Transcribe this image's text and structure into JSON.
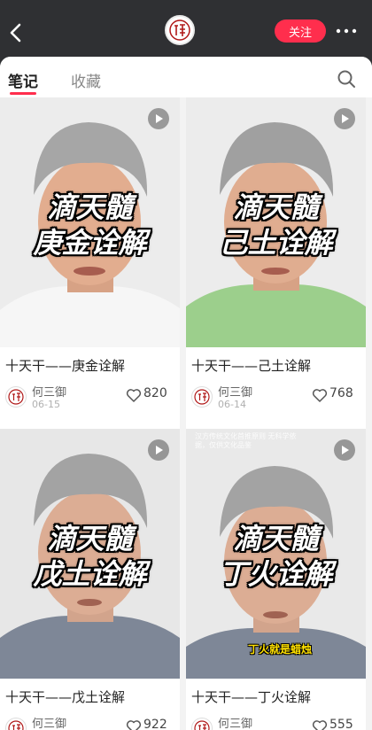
{
  "header": {
    "back_icon": "chevron-left-icon",
    "avatar_icon": "profile-seal-icon",
    "follow_label": "关注",
    "more_icon": "more-dots-icon",
    "accent_color": "#ff2e4d"
  },
  "tabs": [
    {
      "label": "笔记",
      "active": true
    },
    {
      "label": "收藏",
      "active": false
    }
  ],
  "search_icon": "search-icon",
  "cards": [
    {
      "overlay_line1": "滴天髓",
      "overlay_line2": "庚金诠解",
      "title": "十天干——庚金诠解",
      "author": "何三御",
      "date": "06-15",
      "likes": "820",
      "shirt": "#f4f4f4",
      "bg": "#ececec"
    },
    {
      "overlay_line1": "滴天髓",
      "overlay_line2": "己土诠解",
      "title": "十天干——己土诠解",
      "author": "何三御",
      "date": "06-14",
      "likes": "768",
      "shirt": "#9ccf8c",
      "bg": "#ececec"
    },
    {
      "overlay_line1": "滴天髓",
      "overlay_line2": "戊土诠解",
      "title": "十天干——戊土诠解",
      "author": "何三御",
      "date": "",
      "likes": "922",
      "shirt": "#7e8797",
      "bg": "#e7e7e7"
    },
    {
      "overlay_line1": "滴天髓",
      "overlay_line2": "丁火诠解",
      "title": "十天干——丁火诠解",
      "author": "何三御",
      "date": "",
      "likes": "555",
      "shirt": "#7e8797",
      "bg": "#e9e9e9",
      "small_caption": "汉方传统文化首推原则 无科学依据，仅供文化品鉴",
      "sub_caption": "丁火就是蜡烛"
    }
  ]
}
